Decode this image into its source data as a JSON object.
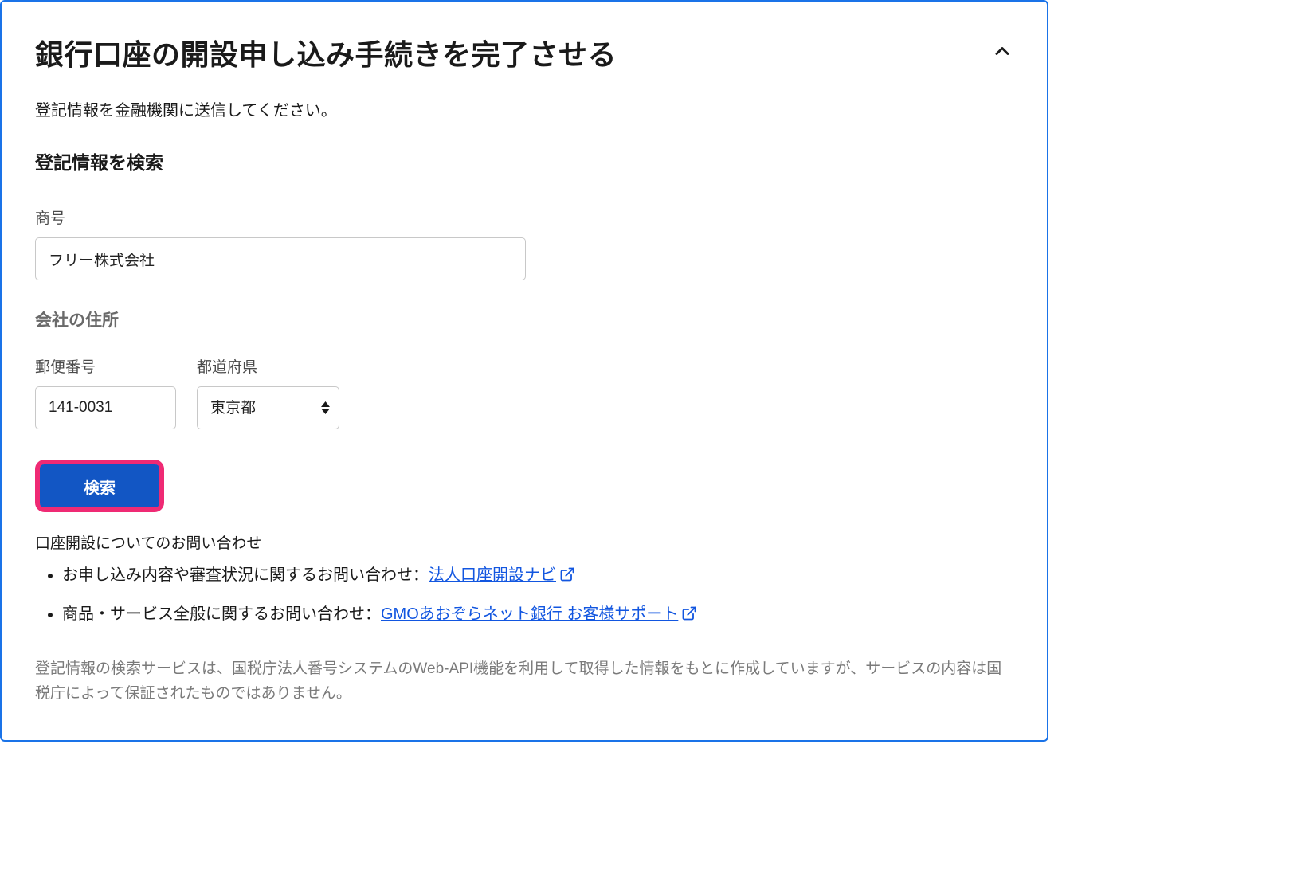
{
  "header": {
    "title": "銀行口座の開設申し込み手続きを完了させる"
  },
  "instruction": "登記情報を金融機関に送信してください。",
  "search": {
    "heading": "登記情報を検索",
    "company_name_label": "商号",
    "company_name_value": "フリー株式会社",
    "address_heading": "会社の住所",
    "postal_label": "郵便番号",
    "postal_value": "141-0031",
    "prefecture_label": "都道府県",
    "prefecture_value": "東京都",
    "button_label": "検索"
  },
  "contact": {
    "heading": "口座開設についてのお問い合わせ",
    "items": [
      {
        "prefix": "お申し込み内容や審査状況に関するお問い合わせ：",
        "link_text": "法人口座開設ナビ"
      },
      {
        "prefix": "商品・サービス全般に関するお問い合わせ：",
        "link_text": "GMOあおぞらネット銀行 お客様サポート"
      }
    ]
  },
  "disclaimer": "登記情報の検索サービスは、国税庁法人番号システムのWeb-API機能を利用して取得した情報をもとに作成していますが、サービスの内容は国税庁によって保証されたものではありません。"
}
